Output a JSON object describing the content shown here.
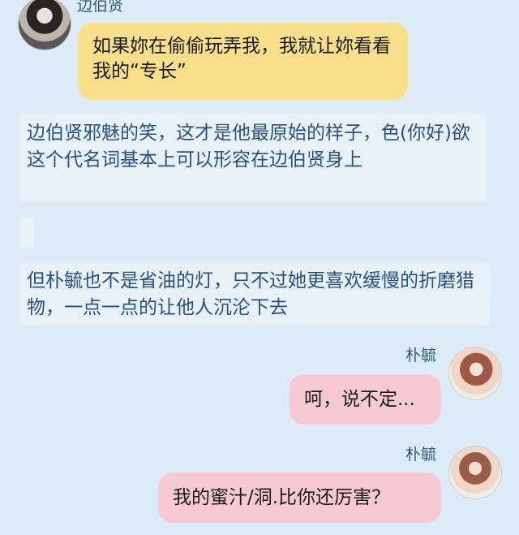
{
  "messages": [
    {
      "sender": "边伯贤",
      "text": "如果妳在偷偷玩弄我，我就让妳看看我的“专长”"
    },
    {
      "sender": "朴毓",
      "text": "呵，说不定..."
    },
    {
      "sender": "朴毓",
      "text": "我的蜜汁/洞.比你还厉害？"
    }
  ],
  "narration": [
    "边伯贤邪魅的笑，这才是他最原始的样子，色(你好)欲这个代名词基本上可以形容在边伯贤身上",
    "",
    "但朴毓也不是省油的灯，只不过她更喜欢缓慢的折磨猎物，一点一点的让他人沉沦下去"
  ],
  "icons": {
    "male_avatar": "avatar-icon",
    "female_avatar": "avatar-icon"
  },
  "colors": {
    "background": "#dcebf5",
    "yellow_bubble": "#f9df8b",
    "pink_bubble": "#f7c9d3",
    "narration_bg": "#e8f1f8",
    "narration_text": "#29507f",
    "name_text": "#2f5f7a"
  }
}
